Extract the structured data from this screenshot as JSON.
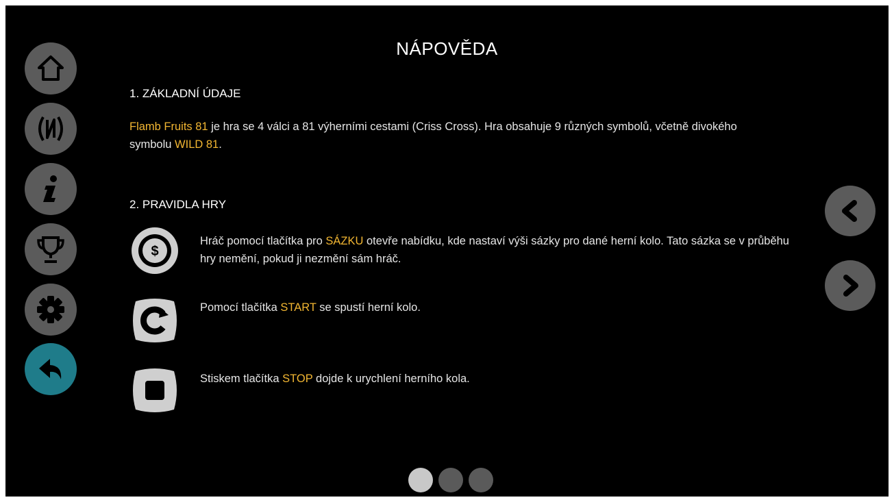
{
  "help": {
    "title": "NÁPOVĚDA",
    "section1": {
      "heading": "1. ZÁKLADNÍ ÚDAJE",
      "game_name": "Flamb Fruits 81",
      "text_a": " je hra se 4 válci a 81 výherními cestami (Criss Cross). Hra obsahuje 9 různých symbolů, včetně divokého symbolu ",
      "wild": "WILD 81",
      "text_b": "."
    },
    "section2": {
      "heading": "2. PRAVIDLA HRY",
      "rules": [
        {
          "icon": "coin-bet-icon",
          "pre": "Hráč pomocí tlačítka pro ",
          "key": "SÁZKU",
          "post": " otevře nabídku, kde nastaví výši sázky pro dané herní kolo. Tato sázka se v průběhu hry nemění, pokud ji nezmění sám hráč."
        },
        {
          "icon": "start-spin-icon",
          "pre": "Pomocí tlačítka ",
          "key": "START",
          "post": " se spustí herní kolo."
        },
        {
          "icon": "stop-icon",
          "pre": "Stiskem tlačítka ",
          "key": "STOP",
          "post": " dojde k urychlení herního kola."
        }
      ]
    }
  },
  "sidebar": {
    "items": [
      {
        "icon": "home-icon"
      },
      {
        "icon": "paytable-icon"
      },
      {
        "icon": "info-icon"
      },
      {
        "icon": "trophy-icon"
      },
      {
        "icon": "settings-icon"
      },
      {
        "icon": "back-arrow-icon",
        "active": true
      }
    ]
  },
  "pagination": {
    "pages": 3,
    "current": 1
  },
  "colors": {
    "background": "#000000",
    "highlight": "#f2b632",
    "button": "#5b5b5b",
    "active_button": "#1f7c8a",
    "dot_active": "#c8c8c8",
    "dot_inactive": "#5a5a5a"
  }
}
